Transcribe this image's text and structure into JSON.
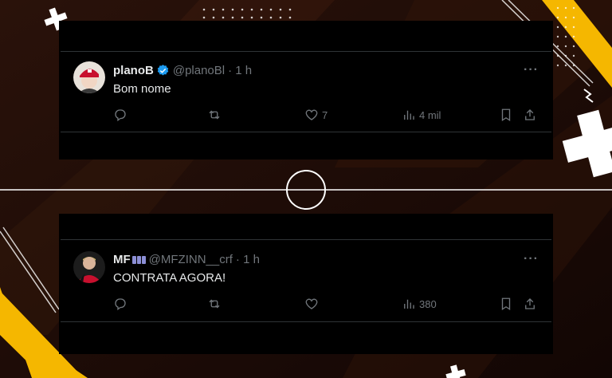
{
  "colors": {
    "accent": "#f5b700",
    "verified": "#1d9bf0",
    "muted": "#71767b",
    "text": "#e7e9ea"
  },
  "tweets": [
    {
      "name": "planoB",
      "handle": "@planoBl",
      "time": "· 1 h",
      "text": "Bom nome",
      "verified": true,
      "more": "···",
      "likes": "7",
      "views": "4 mil"
    },
    {
      "name": "MF",
      "handle": "@MFZINN__crf",
      "time": "· 1 h",
      "text": "CONTRATA AGORA!",
      "verified": false,
      "more": "···",
      "likes": "",
      "views": "380"
    }
  ]
}
